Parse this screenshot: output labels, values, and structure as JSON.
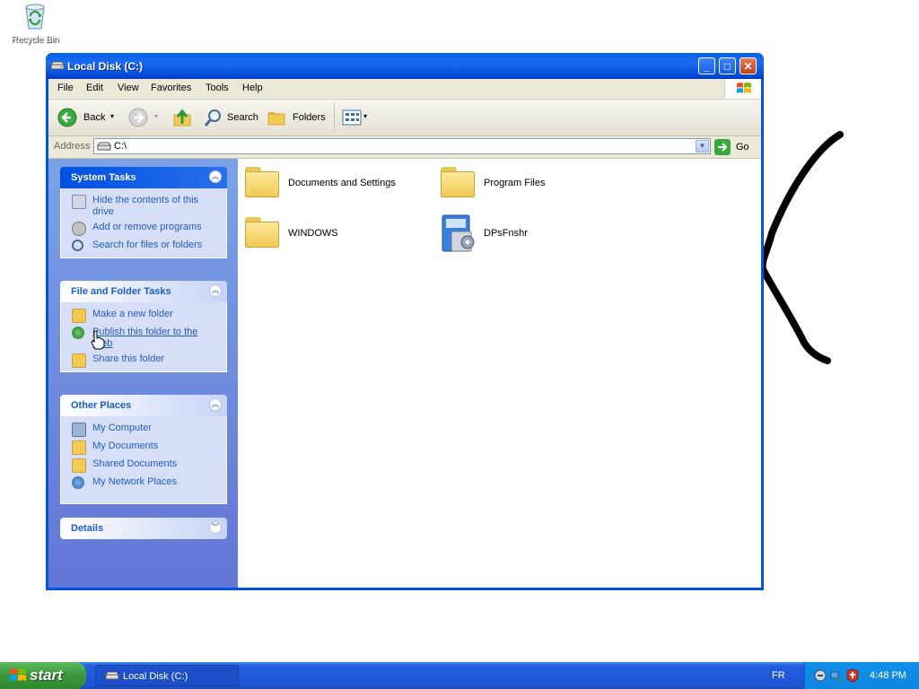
{
  "desktop": {
    "recycle_bin_label": "Recycle Bin"
  },
  "window": {
    "title": "Local Disk (C:)",
    "controls": {
      "minimize": "_",
      "maximize": "□",
      "close": "✕"
    }
  },
  "menu": {
    "items": [
      "File",
      "Edit",
      "View",
      "Favorites",
      "Tools",
      "Help"
    ]
  },
  "toolbar": {
    "back_label": "Back",
    "search_label": "Search",
    "folders_label": "Folders"
  },
  "address": {
    "label": "Address",
    "value": "C:\\",
    "go_label": "Go"
  },
  "task_pane": {
    "system_tasks": {
      "title": "System Tasks",
      "items": [
        "Hide the contents of this drive",
        "Add or remove programs",
        "Search for files or folders"
      ]
    },
    "file_folder_tasks": {
      "title": "File and Folder Tasks",
      "items": [
        "Make a new folder",
        "Publish this folder to the Web",
        "Share this folder"
      ]
    },
    "other_places": {
      "title": "Other Places",
      "items": [
        "My Computer",
        "My Documents",
        "Shared Documents",
        "My Network Places"
      ]
    },
    "details": {
      "title": "Details"
    }
  },
  "files": [
    {
      "name": "Documents and Settings",
      "icon": "folder-icon"
    },
    {
      "name": "Program Files",
      "icon": "folder-icon"
    },
    {
      "name": "WINDOWS",
      "icon": "folder-icon"
    },
    {
      "name": "DPsFnshr",
      "icon": "application-icon"
    }
  ],
  "taskbar": {
    "start_label": "start",
    "task_item": "Local Disk (C:)",
    "language": "FR",
    "clock": "4:48 PM"
  },
  "colors": {
    "window_blue": "#0054e3",
    "task_pane_blue": "#6f8ee0",
    "link_blue": "#215dc6",
    "start_green": "#3c963c"
  }
}
